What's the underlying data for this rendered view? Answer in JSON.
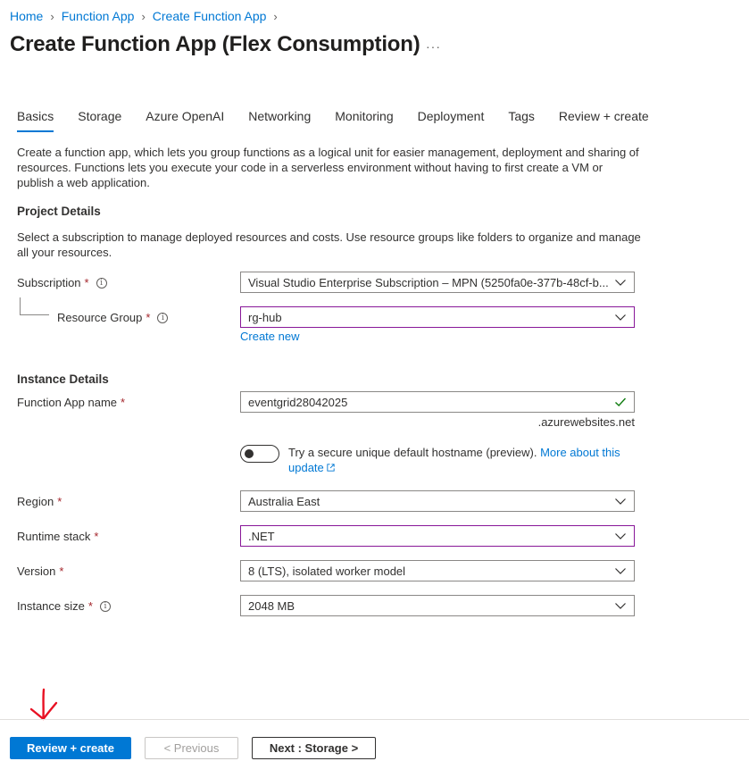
{
  "breadcrumb": [
    "Home",
    "Function App",
    "Create Function App"
  ],
  "title": "Create Function App (Flex Consumption)",
  "more_label": "···",
  "tabs": [
    {
      "label": "Basics",
      "active": true
    },
    {
      "label": "Storage"
    },
    {
      "label": "Azure OpenAI"
    },
    {
      "label": "Networking"
    },
    {
      "label": "Monitoring"
    },
    {
      "label": "Deployment"
    },
    {
      "label": "Tags"
    },
    {
      "label": "Review + create"
    }
  ],
  "intro": "Create a function app, which lets you group functions as a logical unit for easier management, deployment and sharing of resources. Functions lets you execute your code in a serverless environment without having to first create a VM or publish a web application.",
  "project": {
    "title": "Project Details",
    "desc": "Select a subscription to manage deployed resources and costs. Use resource groups like folders to organize and manage all your resources.",
    "subscription_label": "Subscription",
    "subscription_value": "Visual Studio Enterprise Subscription – MPN (5250fa0e-377b-48cf-b...",
    "rg_label": "Resource Group",
    "rg_value": "rg-hub",
    "create_new": "Create new"
  },
  "instance": {
    "title": "Instance Details",
    "name_label": "Function App name",
    "name_value": "eventgrid28042025",
    "suffix": ".azurewebsites.net",
    "toggle_text": "Try a secure unique default hostname (preview).",
    "toggle_on": false,
    "more_link": "More about this update",
    "region_label": "Region",
    "region_value": "Australia East",
    "runtime_label": "Runtime stack",
    "runtime_value": ".NET",
    "version_label": "Version",
    "version_value": "8 (LTS), isolated worker model",
    "size_label": "Instance size",
    "size_value": "2048 MB"
  },
  "required_mark": "*",
  "info_glyph": "i",
  "footer": {
    "review_label": "Review + create",
    "previous_label": "< Previous",
    "next_label": "Next : Storage >"
  },
  "colors": {
    "accent": "#0078d4",
    "required": "#a4262c",
    "focus_border": "#881798",
    "valid_check": "#107c10",
    "annotation_arrow": "#e81123"
  }
}
